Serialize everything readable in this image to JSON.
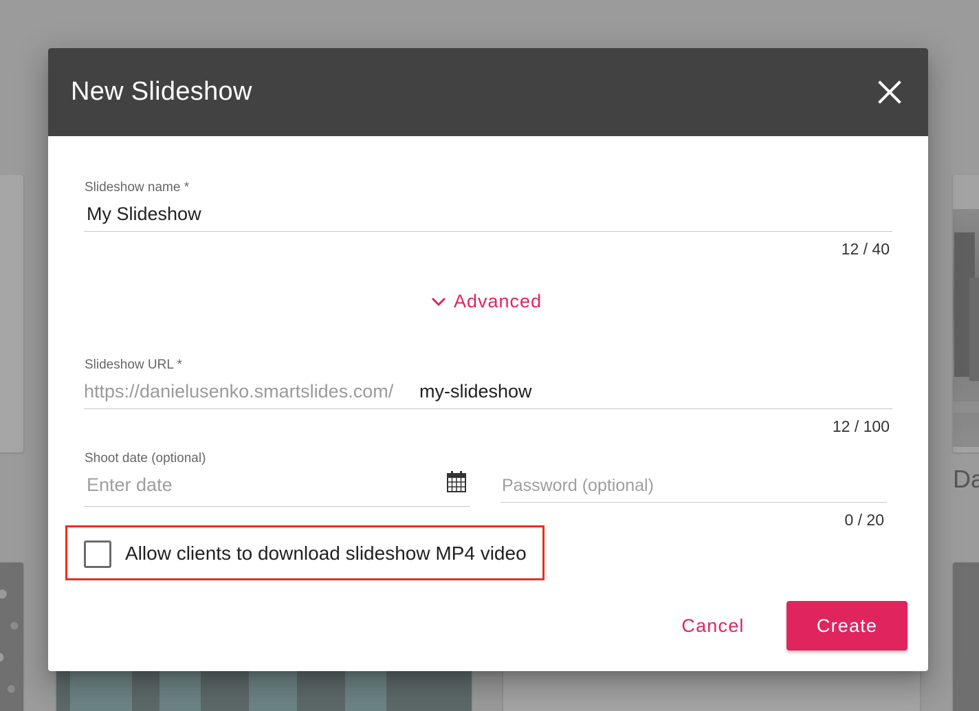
{
  "background": {
    "right_partial_text": "Da"
  },
  "dialog": {
    "title": "New Slideshow",
    "close_icon": "close-icon",
    "name_field": {
      "label": "Slideshow name *",
      "value": "My Slideshow",
      "counter": "12 / 40"
    },
    "advanced": {
      "label": "Advanced",
      "icon": "chevron-down-icon"
    },
    "url_field": {
      "label": "Slideshow URL *",
      "prefix": "https://danielusenko.smartslides.com/",
      "value": "my-slideshow",
      "counter": "12 / 100"
    },
    "shoot_date": {
      "label": "Shoot date (optional)",
      "placeholder": "Enter date",
      "icon": "calendar-icon"
    },
    "password": {
      "placeholder": "Password (optional)",
      "counter": "0 / 20"
    },
    "download_checkbox": {
      "label": "Allow clients to download slideshow MP4 video",
      "checked": false
    },
    "actions": {
      "cancel_label": "Cancel",
      "create_label": "Create"
    }
  },
  "colors": {
    "header_bg": "#424242",
    "accent": "#e0245e",
    "highlight": "#e8301c"
  }
}
